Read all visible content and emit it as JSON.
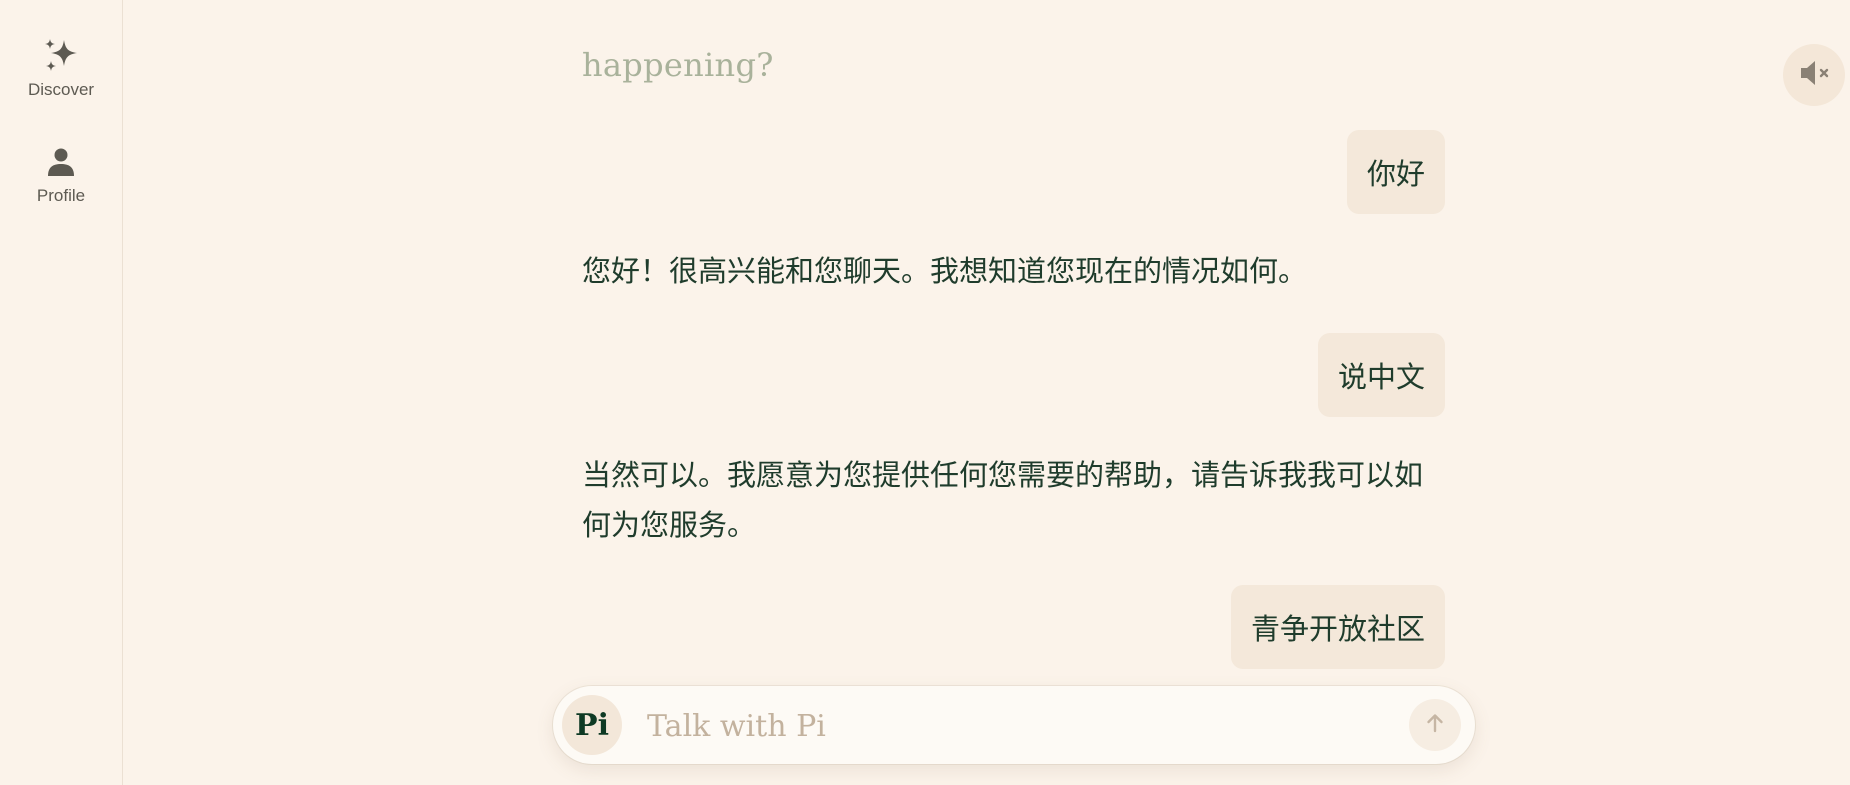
{
  "sidebar": {
    "items": [
      {
        "label": "Discover",
        "icon": "sparkles-icon"
      },
      {
        "label": "Profile",
        "icon": "person-icon"
      }
    ]
  },
  "chat": {
    "faded_text": "happening?",
    "messages": [
      {
        "role": "user",
        "text": "你好"
      },
      {
        "role": "ai",
        "text": "您好！很高兴能和您聊天。我想知道您现在的情况如何。"
      },
      {
        "role": "user",
        "text": "说中文"
      },
      {
        "role": "ai",
        "text": "当然可以。我愿意为您提供任何您需要的帮助，请告诉我我可以如何为您服务。"
      },
      {
        "role": "user",
        "text": "青争开放社区"
      }
    ]
  },
  "input": {
    "logo": "Pi",
    "placeholder": "Talk with Pi",
    "value": ""
  },
  "colors": {
    "background": "#fbf3ea",
    "text": "#1f3c2c",
    "user_bubble": "#f4e8da",
    "faded_text": "#a9b29b",
    "placeholder": "#c3b29e"
  }
}
